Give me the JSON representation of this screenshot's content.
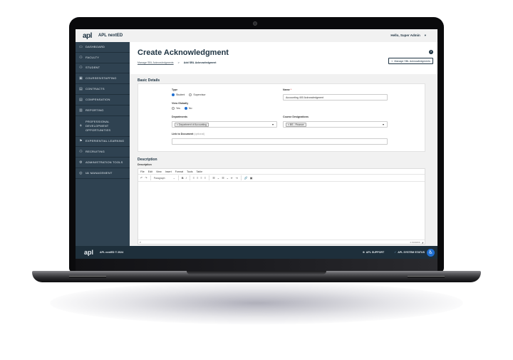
{
  "topbar": {
    "logo": "apl",
    "app_name": "APL nextED",
    "greeting": "Hello, Super Admin",
    "user_caret": "▾"
  },
  "sidebar": {
    "items": [
      {
        "icon": "dashboard-icon",
        "glyph": "▭",
        "label": "Dashboard"
      },
      {
        "icon": "faculty-icon",
        "glyph": "⚇",
        "label": "Faculty"
      },
      {
        "icon": "student-icon",
        "glyph": "⚇",
        "label": "Student"
      },
      {
        "icon": "calendar-icon",
        "glyph": "▣",
        "label": "Courses/Staffing"
      },
      {
        "icon": "contracts-icon",
        "glyph": "▤",
        "label": "Contracts"
      },
      {
        "icon": "compensation-icon",
        "glyph": "▤",
        "label": "Compensation"
      },
      {
        "icon": "reporting-icon",
        "glyph": "▥",
        "label": "Reporting"
      },
      {
        "icon": "professional-development-icon",
        "glyph": "⚘",
        "label": "Professional Development Opportunities"
      },
      {
        "icon": "experiential-learning-icon",
        "glyph": "⚑",
        "label": "Experiential Learning"
      },
      {
        "icon": "recruiting-icon",
        "glyph": "⚇",
        "label": "Recruiting"
      },
      {
        "icon": "admin-tools-icon",
        "glyph": "⚙",
        "label": "Administration Tools"
      },
      {
        "icon": "management-icon",
        "glyph": "◎",
        "label": "I&I Management"
      }
    ]
  },
  "header": {
    "title": "Create Acknowledgment",
    "breadcrumb": {
      "link": "Manage SBL Acknowledgments",
      "separator": ">",
      "current": "Add SBL Acknowledgment"
    },
    "help_glyph": "?",
    "manage_button": {
      "glyph": "«",
      "label": "Manage SBL Acknowledgments"
    }
  },
  "basic_details": {
    "section_title": "Basic Details",
    "type": {
      "label": "Type",
      "options": [
        {
          "label": "Student",
          "selected": true
        },
        {
          "label": "Supervisor",
          "selected": false
        }
      ]
    },
    "view_globally": {
      "label": "View Globally",
      "options": [
        {
          "label": "Yes",
          "selected": false
        },
        {
          "label": "No",
          "selected": true
        }
      ]
    },
    "name": {
      "label": "Name",
      "required_mark": "*",
      "value": "Accounting 400 Acknowledgment"
    },
    "departments": {
      "label": "Departments",
      "chip": "× Department of Accounting"
    },
    "course_designations": {
      "label": "Course Designations",
      "chip": "× BS - Finance"
    },
    "link_to_document": {
      "label": "Link to Document",
      "optional": "(optional)",
      "value": ""
    }
  },
  "description": {
    "section_title": "Description",
    "field_label": "Description",
    "menu": [
      "File",
      "Edit",
      "View",
      "Insert",
      "Format",
      "Tools",
      "Table"
    ],
    "toolbar": {
      "undo": "↶",
      "redo": "↷",
      "block_format": "Paragraph",
      "bold": "B",
      "italic": "I",
      "align_left": "≡",
      "align_center": "≡",
      "align_right": "≡",
      "justify": "≡",
      "bullet_list": "☰",
      "numbered_list": "☰",
      "outdent": "⇤",
      "indent": "⇥",
      "link": "🔗",
      "image": "▣"
    },
    "status_path": "P",
    "word_count": "0 WORDS"
  },
  "footer": {
    "logo": "apl",
    "copyright": "APL nextED © 2024",
    "support": "APL SUPPORT",
    "system_status": "APL SYSTEM STATUS"
  }
}
